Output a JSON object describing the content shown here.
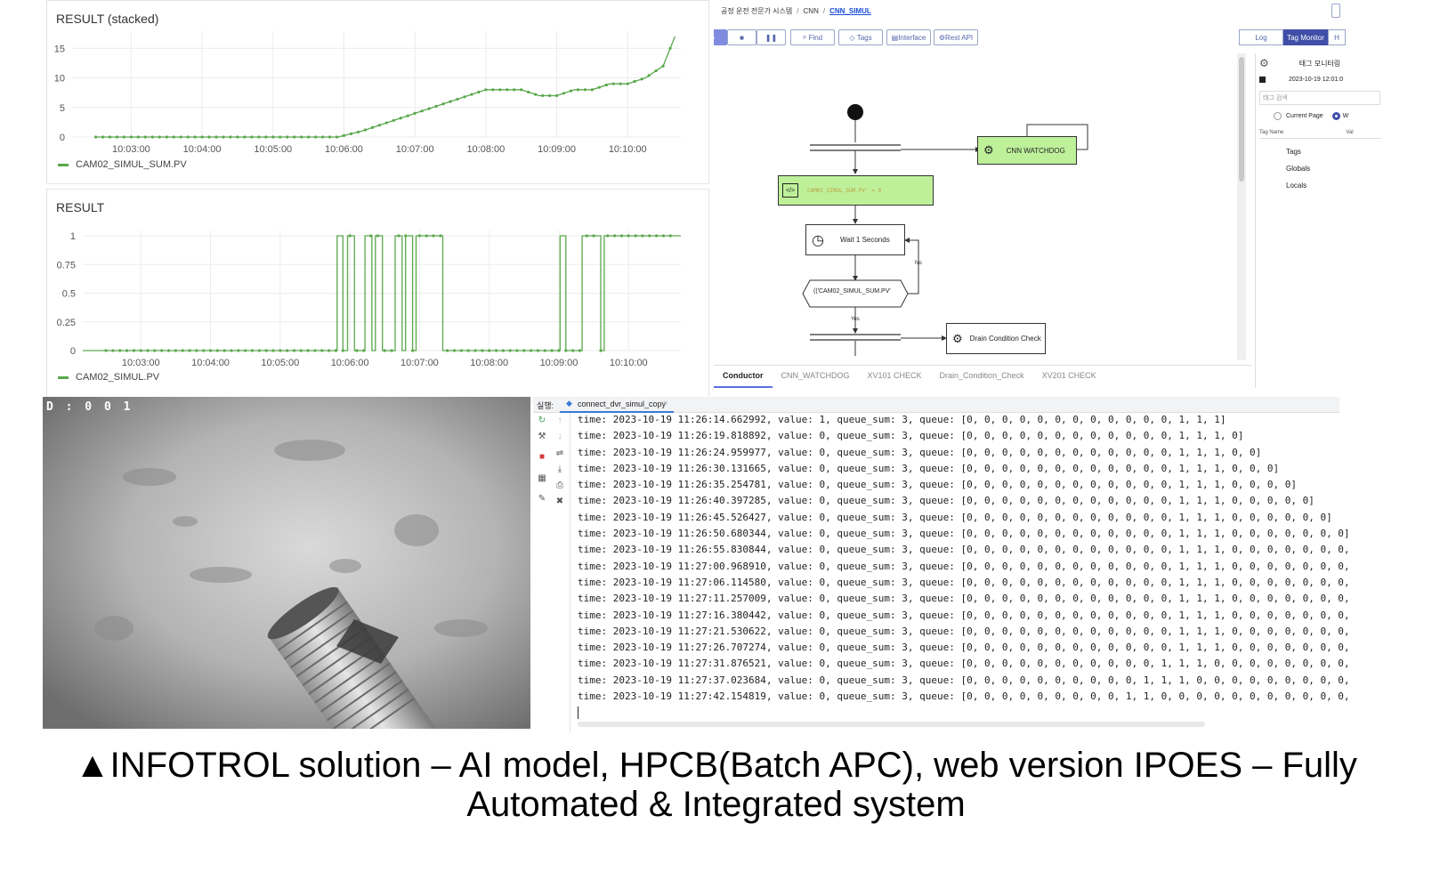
{
  "charts": {
    "stacked": {
      "title": "RESULT (stacked)",
      "legend": "CAM02_SIMUL_SUM.PV",
      "y_ticks": [
        "15",
        "10",
        "5",
        "0"
      ],
      "x_ticks": [
        "10:03:00",
        "10:04:00",
        "10:05:00",
        "10:06:00",
        "10:07:00",
        "10:08:00",
        "10:09:00",
        "10:10:00"
      ]
    },
    "result": {
      "title": "RESULT",
      "legend": "CAM02_SIMUL.PV",
      "y_ticks": [
        "1",
        "0.75",
        "0.5",
        "0.25",
        "0"
      ],
      "x_ticks": [
        "10:03:00",
        "10:04:00",
        "10:05:00",
        "10:06:00",
        "10:07:00",
        "10:08:00",
        "10:09:00",
        "10:10:00"
      ]
    }
  },
  "chart_data": [
    {
      "type": "line",
      "title": "RESULT (stacked)",
      "series": [
        {
          "name": "CAM02_SIMUL_SUM.PV",
          "color": "#5aa84c",
          "x": [
            "10:02:30",
            "10:05:55",
            "10:06:15",
            "10:06:30",
            "10:06:45",
            "10:07:00",
            "10:07:15",
            "10:07:30",
            "10:07:45",
            "10:08:00",
            "10:08:30",
            "10:08:45",
            "10:09:00",
            "10:09:15",
            "10:09:30",
            "10:09:45",
            "10:10:00",
            "10:10:15",
            "10:10:30",
            "10:10:40"
          ],
          "values": [
            0,
            0,
            1,
            2,
            3,
            4,
            5,
            6,
            7,
            8,
            8,
            7,
            7,
            8,
            8,
            9,
            9,
            10,
            12,
            17
          ]
        }
      ],
      "ylim": [
        0,
        17
      ]
    },
    {
      "type": "line",
      "title": "RESULT",
      "series": [
        {
          "name": "CAM02_SIMUL.PV",
          "color": "#5aa84c"
        }
      ],
      "ylim": [
        0,
        1
      ]
    }
  ],
  "app": {
    "breadcrumb": [
      "공정 운전 전문가 시스템",
      "CNN",
      "CNN_SIMUL"
    ],
    "toolbar": {
      "find": "Find",
      "tags": "Tags",
      "interface": "Interface",
      "rest_api": "Rest API"
    },
    "right_tabs": {
      "log": "Log",
      "tag_monitor": "Tag Monitor",
      "more": "H"
    },
    "nodes": {
      "watchdog": "CNN WATCHDOG",
      "script": "CAM02_SIMUL_SUM.PV' = 0",
      "wait": "Wait 1 Seconds",
      "condition": "(('CAM02_SIMUL_SUM.PV'",
      "no": "No",
      "yes": "Yes",
      "drain": "Drain Condition Check"
    },
    "bottom_tabs": [
      "Conductor",
      "CNN_WATCHDOG",
      "XV101 CHECK",
      "Drain_Condition_Check",
      "XV201 CHECK"
    ],
    "tag_monitor": {
      "title": "태그 모니터링",
      "timestamp": "2023-10-19 12:01:0",
      "search_placeholder": "태그 검색",
      "radio_current": "Current Page",
      "radio_other": "W",
      "col_name": "Tag Name",
      "col_val": "Val",
      "tree": [
        "Tags",
        "Globals",
        "Locals"
      ]
    }
  },
  "camera": {
    "label": "D : 0 0 1"
  },
  "console": {
    "run_label": "실행:",
    "tab_name": "connect_dvr_simul_copy",
    "lines": [
      "time: 2023-10-19 11:26:14.662992, value: 1, queue_sum: 3, queue: [0, 0, 0, 0, 0, 0, 0, 0, 0, 0, 0, 0, 1, 1, 1]",
      "time: 2023-10-19 11:26:19.818892, value: 0, queue_sum: 3, queue: [0, 0, 0, 0, 0, 0, 0, 0, 0, 0, 0, 0, 1, 1, 1, 0]",
      "time: 2023-10-19 11:26:24.959977, value: 0, queue_sum: 3, queue: [0, 0, 0, 0, 0, 0, 0, 0, 0, 0, 0, 0, 1, 1, 1, 0, 0]",
      "time: 2023-10-19 11:26:30.131665, value: 0, queue_sum: 3, queue: [0, 0, 0, 0, 0, 0, 0, 0, 0, 0, 0, 0, 1, 1, 1, 0, 0, 0]",
      "time: 2023-10-19 11:26:35.254781, value: 0, queue_sum: 3, queue: [0, 0, 0, 0, 0, 0, 0, 0, 0, 0, 0, 0, 1, 1, 1, 0, 0, 0, 0]",
      "time: 2023-10-19 11:26:40.397285, value: 0, queue_sum: 3, queue: [0, 0, 0, 0, 0, 0, 0, 0, 0, 0, 0, 0, 1, 1, 1, 0, 0, 0, 0, 0]",
      "time: 2023-10-19 11:26:45.526427, value: 0, queue_sum: 3, queue: [0, 0, 0, 0, 0, 0, 0, 0, 0, 0, 0, 0, 1, 1, 1, 0, 0, 0, 0, 0, 0]",
      "time: 2023-10-19 11:26:50.680344, value: 0, queue_sum: 3, queue: [0, 0, 0, 0, 0, 0, 0, 0, 0, 0, 0, 0, 1, 1, 1, 0, 0, 0, 0, 0, 0, 0]",
      "time: 2023-10-19 11:26:55.830844, value: 0, queue_sum: 3, queue: [0, 0, 0, 0, 0, 0, 0, 0, 0, 0, 0, 0, 1, 1, 1, 0, 0, 0, 0, 0, 0, 0,",
      "time: 2023-10-19 11:27:00.968910, value: 0, queue_sum: 3, queue: [0, 0, 0, 0, 0, 0, 0, 0, 0, 0, 0, 0, 1, 1, 1, 0, 0, 0, 0, 0, 0, 0,",
      "time: 2023-10-19 11:27:06.114580, value: 0, queue_sum: 3, queue: [0, 0, 0, 0, 0, 0, 0, 0, 0, 0, 0, 0, 1, 1, 1, 0, 0, 0, 0, 0, 0, 0,",
      "time: 2023-10-19 11:27:11.257009, value: 0, queue_sum: 3, queue: [0, 0, 0, 0, 0, 0, 0, 0, 0, 0, 0, 0, 1, 1, 1, 0, 0, 0, 0, 0, 0, 0,",
      "time: 2023-10-19 11:27:16.380442, value: 0, queue_sum: 3, queue: [0, 0, 0, 0, 0, 0, 0, 0, 0, 0, 0, 0, 1, 1, 1, 0, 0, 0, 0, 0, 0, 0,",
      "time: 2023-10-19 11:27:21.530622, value: 0, queue_sum: 3, queue: [0, 0, 0, 0, 0, 0, 0, 0, 0, 0, 0, 0, 1, 1, 1, 0, 0, 0, 0, 0, 0, 0,",
      "time: 2023-10-19 11:27:26.707274, value: 0, queue_sum: 3, queue: [0, 0, 0, 0, 0, 0, 0, 0, 0, 0, 0, 0, 1, 1, 1, 0, 0, 0, 0, 0, 0, 0,",
      "time: 2023-10-19 11:27:31.876521, value: 0, queue_sum: 3, queue: [0, 0, 0, 0, 0, 0, 0, 0, 0, 0, 0, 1, 1, 1, 0, 0, 0, 0, 0, 0, 0, 0,",
      "time: 2023-10-19 11:27:37.023684, value: 0, queue_sum: 3, queue: [0, 0, 0, 0, 0, 0, 0, 0, 0, 0, 1, 1, 1, 0, 0, 0, 0, 0, 0, 0, 0, 0,",
      "time: 2023-10-19 11:27:42.154819, value: 0, queue_sum: 3, queue: [0, 0, 0, 0, 0, 0, 0, 0, 0, 1, 1, 0, 0, 0, 0, 0, 0, 0, 0, 0, 0, 0,"
    ]
  },
  "caption": {
    "line1": "▲INFOTROL solution – AI model, HPCB(Batch APC), web version IPOES –  Fully",
    "line2": "Automated & Integrated system"
  }
}
